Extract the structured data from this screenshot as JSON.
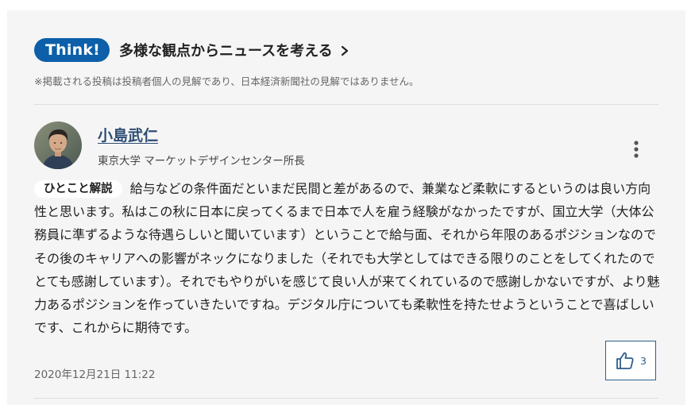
{
  "header": {
    "badge": "Think!",
    "title": "多様な観点からニュースを考える",
    "disclaimer": "※掲載される投稿は投稿者個人の見解であり、日本経済新聞社の見解ではありません。"
  },
  "post": {
    "author_name": "小島武仁",
    "author_title": "東京大学 マーケットデザインセンター所長",
    "tag": "ひとこと解説",
    "body": "給与などの条件面だといまだ民間と差があるので、兼業など柔軟にするというのは良い方向性と思います。私はこの秋に日本に戻ってくるまで日本で人を雇う経験がなかったですが、国立大学（大体公務員に準ずるような待遇らしいと聞いています）ということで給与面、それから年限のあるポジションなのでその後のキャリアへの影響がネックになりました（それでも大学としてはできる限りのことをしてくれたのでとても感謝しています）。それでもやりがいを感じて良い人が来てくれているので感謝しかないですが、より魅力あるポジションを作っていきたいですね。デジタル庁についても柔軟性を持たせようということで喜ばしいです、これからに期待です。",
    "timestamp": "2020年12月21日 11:22",
    "like_count": "3"
  },
  "colors": {
    "accent": "#0c5fa8",
    "author_link": "#2d4d73",
    "panel_bg": "#f5f5f5"
  },
  "icons": {
    "chevron": "chevron-right-icon",
    "more": "more-vertical-icon",
    "like": "thumbs-up-icon"
  }
}
